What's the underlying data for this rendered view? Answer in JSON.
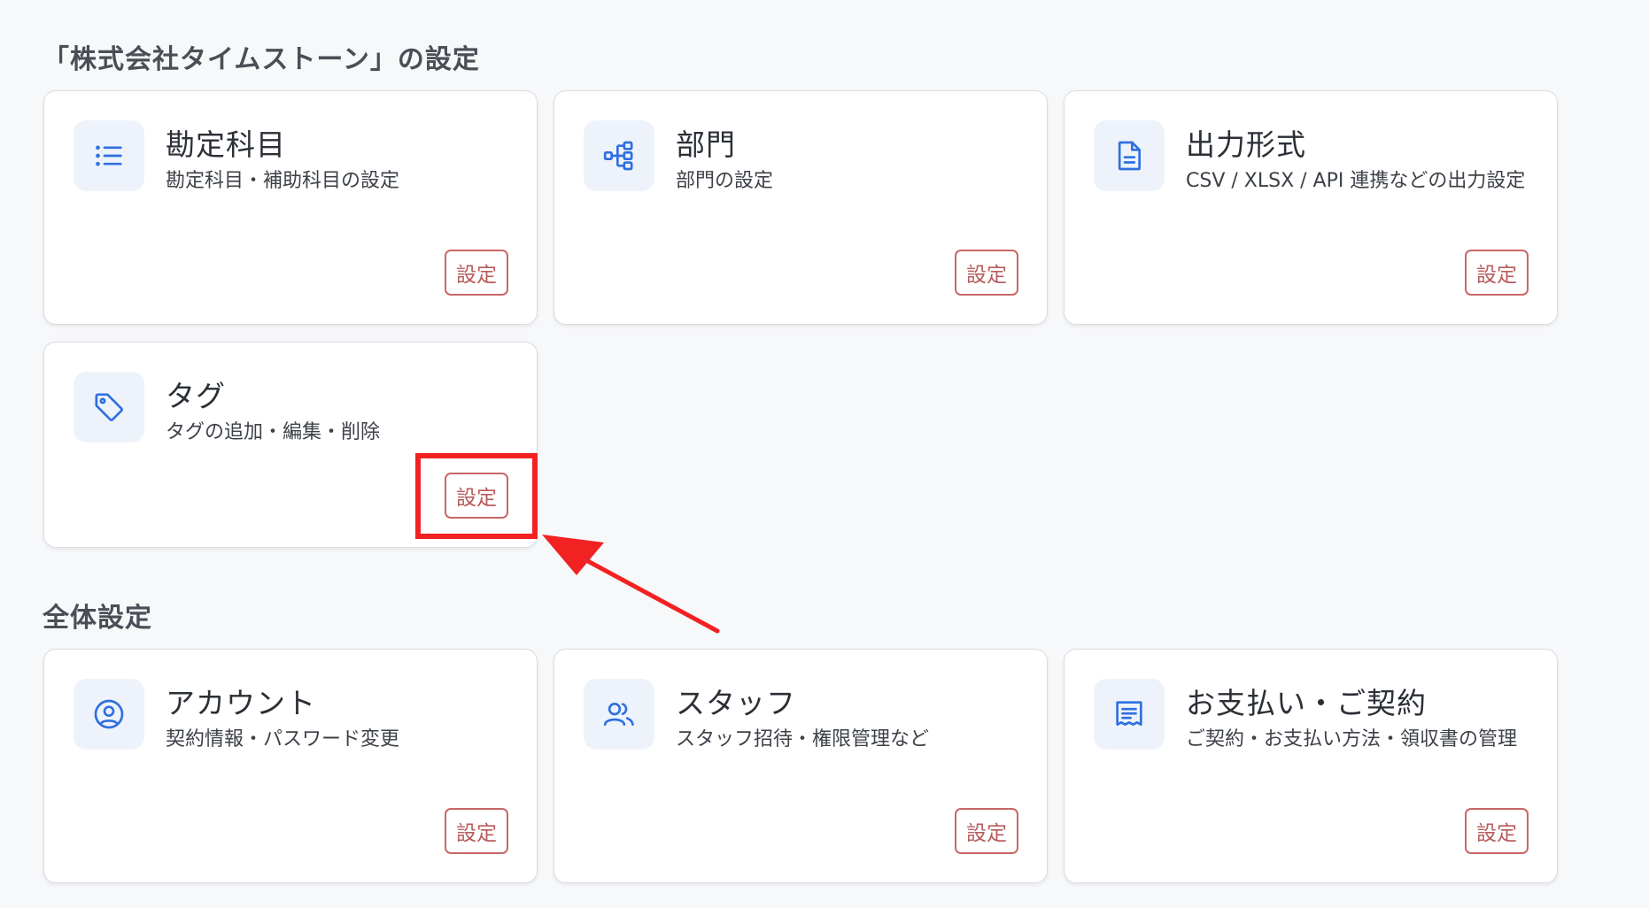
{
  "company_section": {
    "title": "「株式会社タイムストーン」の設定",
    "cards": [
      {
        "title": "勘定科目",
        "desc": "勘定科目・補助科目の設定",
        "button": "設定",
        "icon": "list-icon"
      },
      {
        "title": "部門",
        "desc": "部門の設定",
        "button": "設定",
        "icon": "hierarchy-icon"
      },
      {
        "title": "出力形式",
        "desc": "CSV / XLSX / API 連携などの出力設定",
        "button": "設定",
        "icon": "document-icon"
      },
      {
        "title": "タグ",
        "desc": "タグの追加・編集・削除",
        "button": "設定",
        "icon": "tag-icon"
      }
    ]
  },
  "global_section": {
    "title": "全体設定",
    "cards": [
      {
        "title": "アカウント",
        "desc": "契約情報・パスワード変更",
        "button": "設定",
        "icon": "user-circle-icon"
      },
      {
        "title": "スタッフ",
        "desc": "スタッフ招待・権限管理など",
        "button": "設定",
        "icon": "users-icon"
      },
      {
        "title": "お支払い・ご契約",
        "desc": "ご契約・お支払い方法・領収書の管理",
        "button": "設定",
        "icon": "receipt-icon"
      }
    ]
  },
  "colors": {
    "icon": "#2f6fe0",
    "icon_bg": "#eef3fb",
    "button_border": "#c96767",
    "annotation": "#f22222"
  }
}
